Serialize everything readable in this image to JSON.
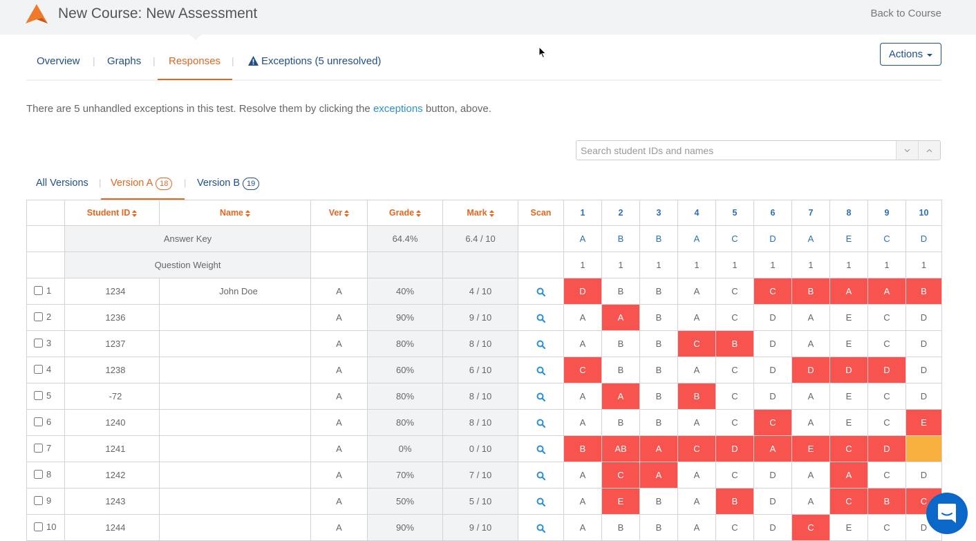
{
  "header": {
    "title": "New Course: New Assessment",
    "back_link": "Back to Course",
    "brand_color": "#e5661f"
  },
  "nav": {
    "tabs": [
      {
        "label": "Overview",
        "active": false
      },
      {
        "label": "Graphs",
        "active": false
      },
      {
        "label": "Responses",
        "active": true
      },
      {
        "label": "Exceptions (5 unresolved)",
        "active": false,
        "icon": "warning-icon"
      }
    ],
    "actions_label": "Actions"
  },
  "notice": {
    "before": "There are 5 unhandled exceptions in this test. Resolve them by clicking the ",
    "link": "exceptions",
    "after": " button, above."
  },
  "search": {
    "placeholder": "Search student IDs and names",
    "value": ""
  },
  "version_tabs": [
    {
      "label": "All Versions",
      "active": false
    },
    {
      "label": "Version A",
      "count": "18",
      "active": true
    },
    {
      "label": "Version B",
      "count": "19",
      "active": false
    }
  ],
  "table": {
    "headers": {
      "student_id": "Student ID",
      "name": "Name",
      "ver": "Ver",
      "grade": "Grade",
      "mark": "Mark",
      "scan": "Scan",
      "questions": [
        "1",
        "2",
        "3",
        "4",
        "5",
        "6",
        "7",
        "8",
        "9",
        "10"
      ]
    },
    "answer_key": {
      "label": "Answer Key",
      "grade": "64.4%",
      "mark": "6.4 / 10",
      "answers": [
        "A",
        "B",
        "B",
        "A",
        "C",
        "D",
        "A",
        "E",
        "C",
        "D"
      ]
    },
    "question_weight": {
      "label": "Question Weight",
      "weights": [
        "1",
        "1",
        "1",
        "1",
        "1",
        "1",
        "1",
        "1",
        "1",
        "1"
      ]
    },
    "rows": [
      {
        "num": "1",
        "id": "1234",
        "name": "John Doe",
        "ver": "A",
        "grade": "40%",
        "mark": "4 / 10",
        "answers": [
          "D",
          "B",
          "B",
          "A",
          "C",
          "C",
          "B",
          "A",
          "A",
          "B"
        ]
      },
      {
        "num": "2",
        "id": "1236",
        "name": "",
        "ver": "A",
        "grade": "90%",
        "mark": "9 / 10",
        "answers": [
          "A",
          "A",
          "B",
          "A",
          "C",
          "D",
          "A",
          "E",
          "C",
          "D"
        ]
      },
      {
        "num": "3",
        "id": "1237",
        "name": "",
        "ver": "A",
        "grade": "80%",
        "mark": "8 / 10",
        "answers": [
          "A",
          "B",
          "B",
          "C",
          "B",
          "D",
          "A",
          "E",
          "C",
          "D"
        ]
      },
      {
        "num": "4",
        "id": "1238",
        "name": "",
        "ver": "A",
        "grade": "60%",
        "mark": "6 / 10",
        "answers": [
          "C",
          "B",
          "B",
          "A",
          "C",
          "D",
          "D",
          "D",
          "D",
          "D"
        ]
      },
      {
        "num": "5",
        "id": "-72",
        "name": "",
        "ver": "A",
        "grade": "80%",
        "mark": "8 / 10",
        "answers": [
          "A",
          "A",
          "B",
          "B",
          "C",
          "D",
          "A",
          "E",
          "C",
          "D"
        ]
      },
      {
        "num": "6",
        "id": "1240",
        "name": "",
        "ver": "A",
        "grade": "80%",
        "mark": "8 / 10",
        "answers": [
          "A",
          "B",
          "B",
          "A",
          "C",
          "C",
          "A",
          "E",
          "C",
          "E"
        ]
      },
      {
        "num": "7",
        "id": "1241",
        "name": "",
        "ver": "A",
        "grade": "0%",
        "mark": "0 / 10",
        "answers": [
          "B",
          "AB",
          "A",
          "C",
          "D",
          "A",
          "E",
          "C",
          "D",
          ""
        ]
      },
      {
        "num": "8",
        "id": "1242",
        "name": "",
        "ver": "A",
        "grade": "70%",
        "mark": "7 / 10",
        "answers": [
          "A",
          "C",
          "A",
          "A",
          "C",
          "D",
          "A",
          "A",
          "C",
          "D"
        ]
      },
      {
        "num": "9",
        "id": "1243",
        "name": "",
        "ver": "A",
        "grade": "50%",
        "mark": "5 / 10",
        "answers": [
          "A",
          "E",
          "B",
          "A",
          "B",
          "D",
          "A",
          "C",
          "B",
          "C"
        ]
      },
      {
        "num": "10",
        "id": "1244",
        "name": "",
        "ver": "A",
        "grade": "90%",
        "mark": "9 / 10",
        "answers": [
          "A",
          "B",
          "B",
          "A",
          "C",
          "D",
          "C",
          "E",
          "C",
          "D"
        ]
      }
    ],
    "colors": {
      "wrong": "#f7534f",
      "blank": "#f8b13e",
      "key": "#2c6fb7"
    }
  }
}
